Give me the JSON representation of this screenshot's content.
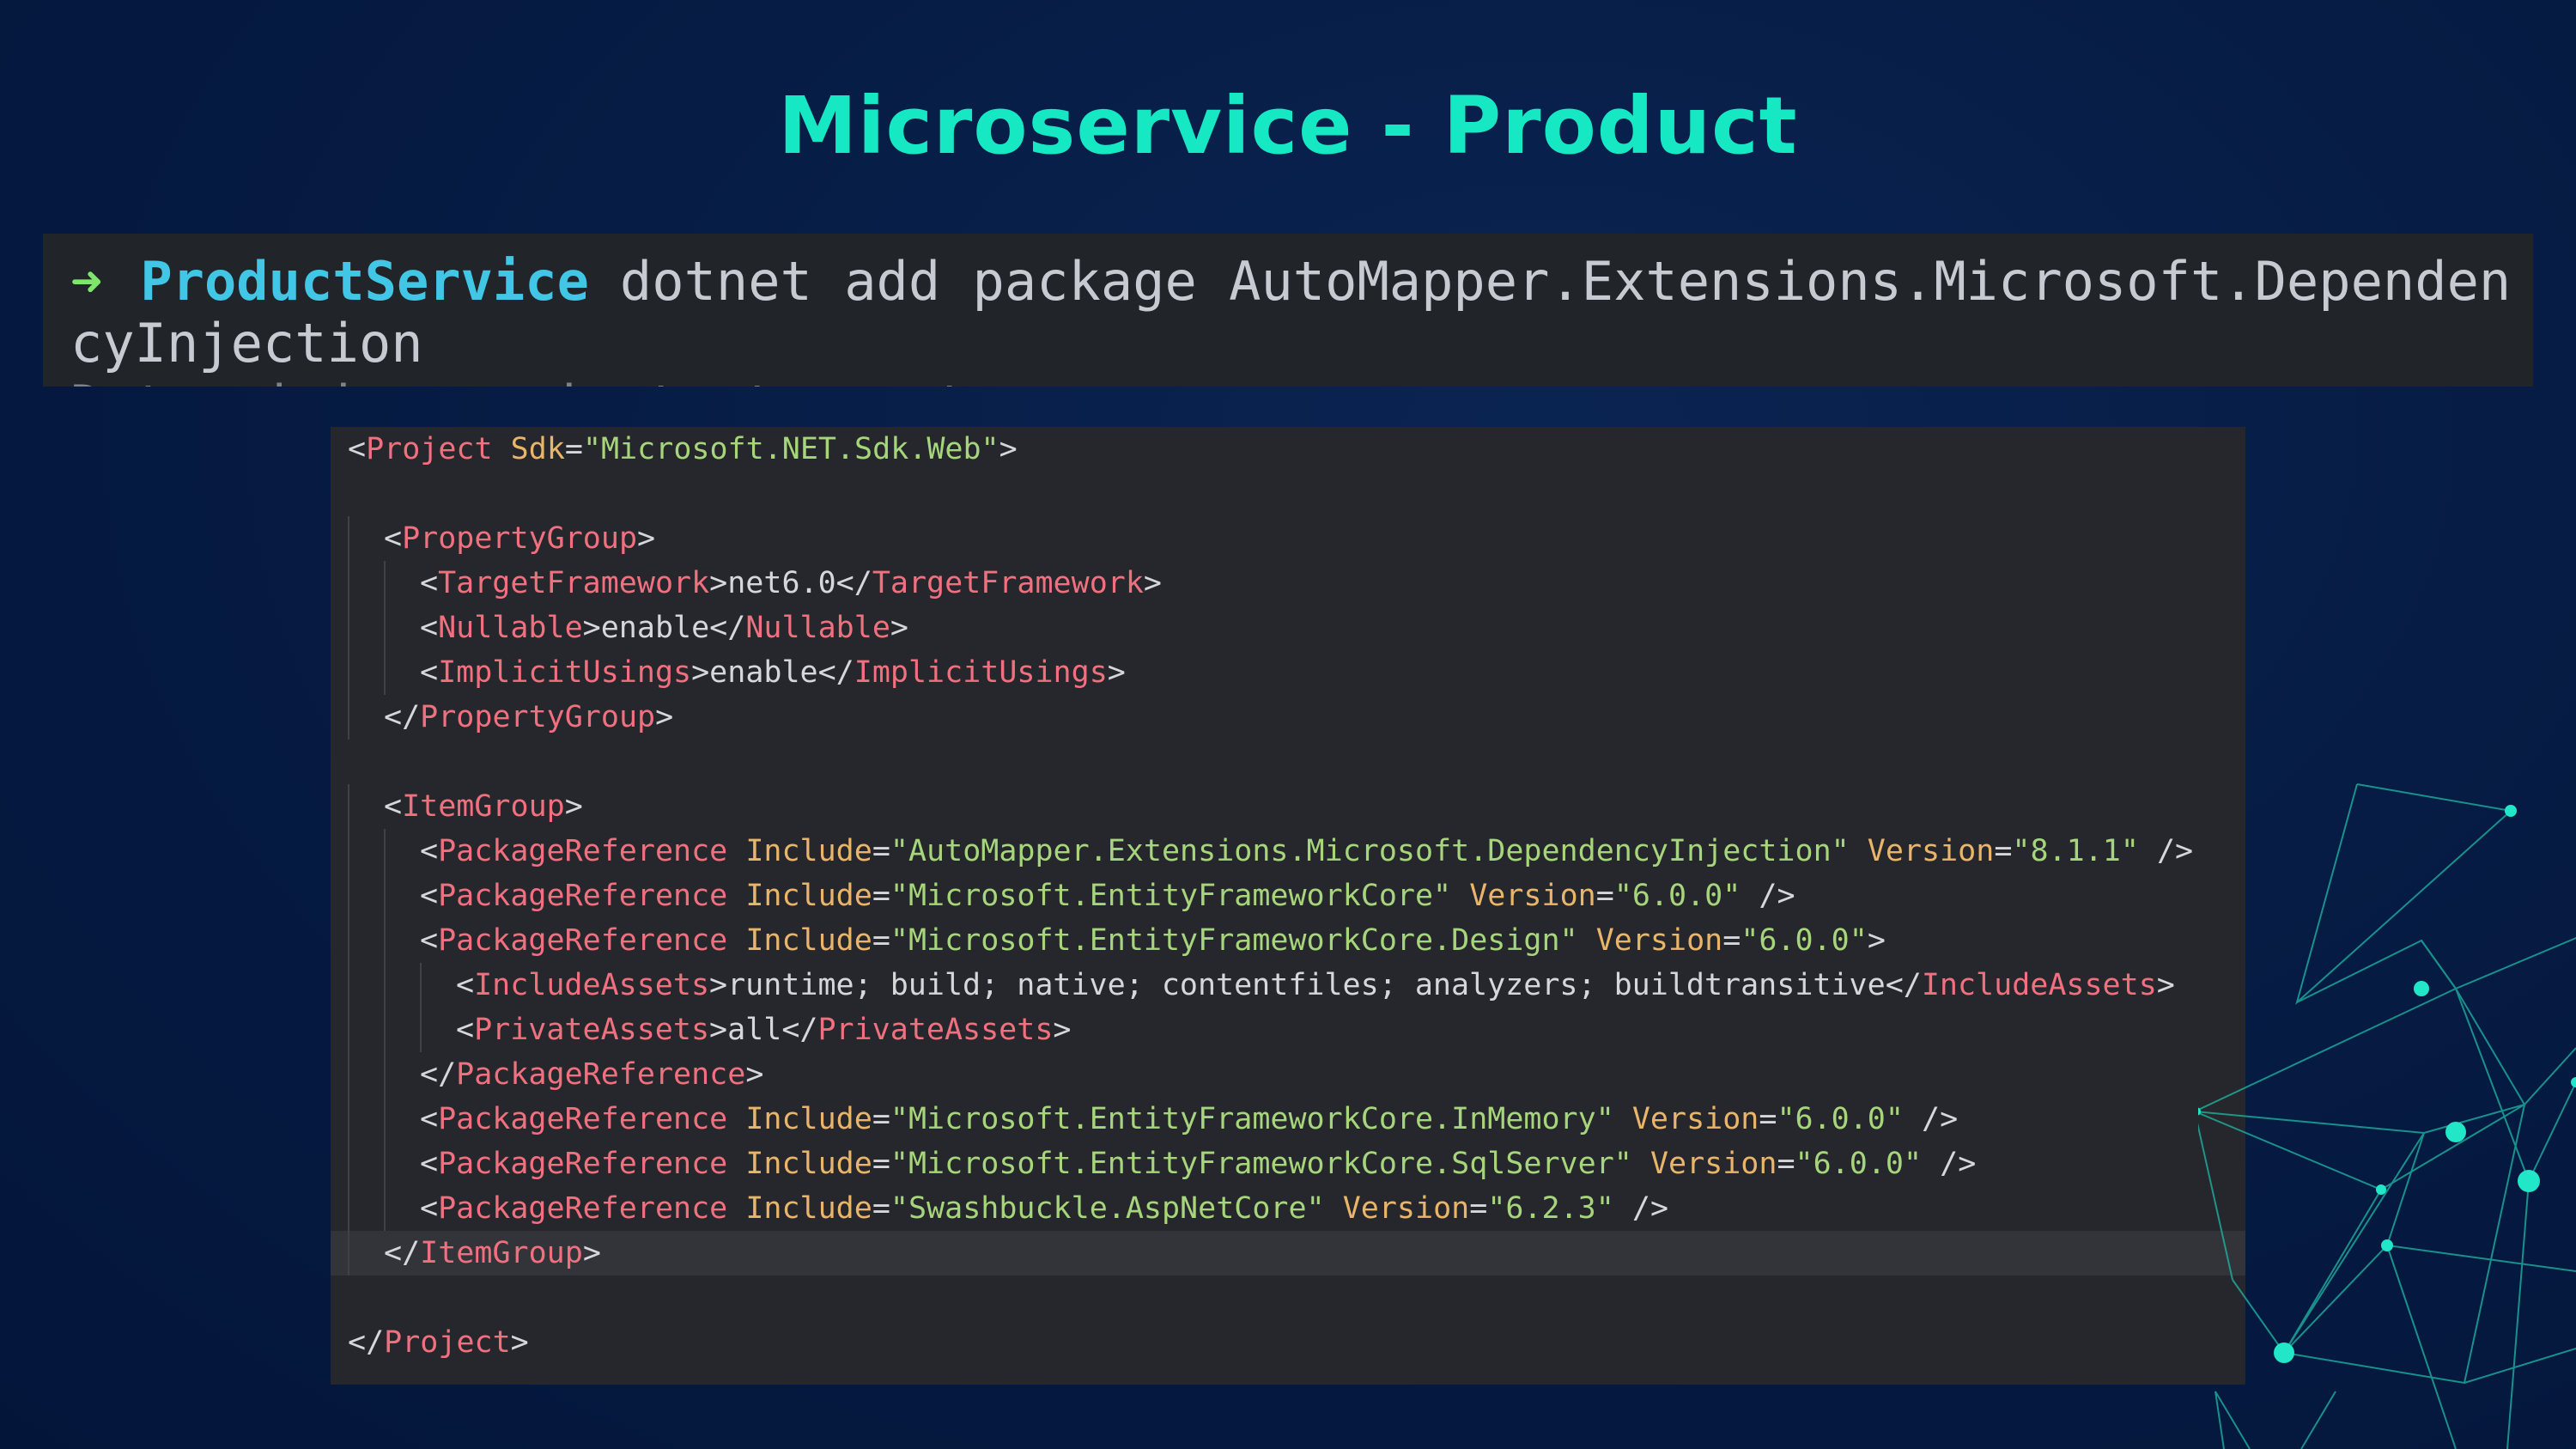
{
  "slide": {
    "title": "Microservice - Product",
    "title_color": "#17e8c4"
  },
  "terminal": {
    "prompt_symbol": "➜",
    "directory": "ProductService",
    "command_part1": "dotnet add package AutoMapper.Extensions.Microsoft.Dependen",
    "command_part2": "cyInjection",
    "partial_next_line": "  Determining projects to restore..."
  },
  "code": {
    "language": "xml",
    "lines": [
      {
        "indent": 0,
        "tokens": [
          [
            "punc",
            "<"
          ],
          [
            "tag",
            "Project"
          ],
          [
            "punc",
            " "
          ],
          [
            "attr",
            "Sdk"
          ],
          [
            "punc",
            "="
          ],
          [
            "str",
            "\"Microsoft.NET.Sdk.Web\""
          ],
          [
            "punc",
            ">"
          ]
        ]
      },
      {
        "indent": 0,
        "tokens": []
      },
      {
        "indent": 1,
        "tokens": [
          [
            "punc",
            "<"
          ],
          [
            "tag",
            "PropertyGroup"
          ],
          [
            "punc",
            ">"
          ]
        ]
      },
      {
        "indent": 2,
        "tokens": [
          [
            "punc",
            "<"
          ],
          [
            "tag",
            "TargetFramework"
          ],
          [
            "punc",
            ">"
          ],
          [
            "txt",
            "net6.0"
          ],
          [
            "punc",
            "</"
          ],
          [
            "tag",
            "TargetFramework"
          ],
          [
            "punc",
            ">"
          ]
        ]
      },
      {
        "indent": 2,
        "tokens": [
          [
            "punc",
            "<"
          ],
          [
            "tag",
            "Nullable"
          ],
          [
            "punc",
            ">"
          ],
          [
            "txt",
            "enable"
          ],
          [
            "punc",
            "</"
          ],
          [
            "tag",
            "Nullable"
          ],
          [
            "punc",
            ">"
          ]
        ]
      },
      {
        "indent": 2,
        "tokens": [
          [
            "punc",
            "<"
          ],
          [
            "tag",
            "ImplicitUsings"
          ],
          [
            "punc",
            ">"
          ],
          [
            "txt",
            "enable"
          ],
          [
            "punc",
            "</"
          ],
          [
            "tag",
            "ImplicitUsings"
          ],
          [
            "punc",
            ">"
          ]
        ]
      },
      {
        "indent": 1,
        "tokens": [
          [
            "punc",
            "</"
          ],
          [
            "tag",
            "PropertyGroup"
          ],
          [
            "punc",
            ">"
          ]
        ]
      },
      {
        "indent": 0,
        "tokens": []
      },
      {
        "indent": 1,
        "tokens": [
          [
            "punc",
            "<"
          ],
          [
            "tag",
            "ItemGroup"
          ],
          [
            "punc",
            ">"
          ]
        ]
      },
      {
        "indent": 2,
        "tokens": [
          [
            "punc",
            "<"
          ],
          [
            "tag",
            "PackageReference"
          ],
          [
            "punc",
            " "
          ],
          [
            "attr",
            "Include"
          ],
          [
            "punc",
            "="
          ],
          [
            "str",
            "\"AutoMapper.Extensions.Microsoft.DependencyInjection\""
          ],
          [
            "punc",
            " "
          ],
          [
            "attr",
            "Version"
          ],
          [
            "punc",
            "="
          ],
          [
            "str",
            "\"8.1.1\""
          ],
          [
            "punc",
            " />"
          ]
        ]
      },
      {
        "indent": 2,
        "tokens": [
          [
            "punc",
            "<"
          ],
          [
            "tag",
            "PackageReference"
          ],
          [
            "punc",
            " "
          ],
          [
            "attr",
            "Include"
          ],
          [
            "punc",
            "="
          ],
          [
            "str",
            "\"Microsoft.EntityFrameworkCore\""
          ],
          [
            "punc",
            " "
          ],
          [
            "attr",
            "Version"
          ],
          [
            "punc",
            "="
          ],
          [
            "str",
            "\"6.0.0\""
          ],
          [
            "punc",
            " />"
          ]
        ]
      },
      {
        "indent": 2,
        "tokens": [
          [
            "punc",
            "<"
          ],
          [
            "tag",
            "PackageReference"
          ],
          [
            "punc",
            " "
          ],
          [
            "attr",
            "Include"
          ],
          [
            "punc",
            "="
          ],
          [
            "str",
            "\"Microsoft.EntityFrameworkCore.Design\""
          ],
          [
            "punc",
            " "
          ],
          [
            "attr",
            "Version"
          ],
          [
            "punc",
            "="
          ],
          [
            "str",
            "\"6.0.0\""
          ],
          [
            "punc",
            ">"
          ]
        ]
      },
      {
        "indent": 3,
        "tokens": [
          [
            "punc",
            "<"
          ],
          [
            "tag",
            "IncludeAssets"
          ],
          [
            "punc",
            ">"
          ],
          [
            "txt",
            "runtime; build; native; contentfiles; analyzers; buildtransitive"
          ],
          [
            "punc",
            "</"
          ],
          [
            "tag",
            "IncludeAssets"
          ],
          [
            "punc",
            ">"
          ]
        ]
      },
      {
        "indent": 3,
        "tokens": [
          [
            "punc",
            "<"
          ],
          [
            "tag",
            "PrivateAssets"
          ],
          [
            "punc",
            ">"
          ],
          [
            "txt",
            "all"
          ],
          [
            "punc",
            "</"
          ],
          [
            "tag",
            "PrivateAssets"
          ],
          [
            "punc",
            ">"
          ]
        ]
      },
      {
        "indent": 2,
        "tokens": [
          [
            "punc",
            "</"
          ],
          [
            "tag",
            "PackageReference"
          ],
          [
            "punc",
            ">"
          ]
        ]
      },
      {
        "indent": 2,
        "tokens": [
          [
            "punc",
            "<"
          ],
          [
            "tag",
            "PackageReference"
          ],
          [
            "punc",
            " "
          ],
          [
            "attr",
            "Include"
          ],
          [
            "punc",
            "="
          ],
          [
            "str",
            "\"Microsoft.EntityFrameworkCore.InMemory\""
          ],
          [
            "punc",
            " "
          ],
          [
            "attr",
            "Version"
          ],
          [
            "punc",
            "="
          ],
          [
            "str",
            "\"6.0.0\""
          ],
          [
            "punc",
            " />"
          ]
        ]
      },
      {
        "indent": 2,
        "tokens": [
          [
            "punc",
            "<"
          ],
          [
            "tag",
            "PackageReference"
          ],
          [
            "punc",
            " "
          ],
          [
            "attr",
            "Include"
          ],
          [
            "punc",
            "="
          ],
          [
            "str",
            "\"Microsoft.EntityFrameworkCore.SqlServer\""
          ],
          [
            "punc",
            " "
          ],
          [
            "attr",
            "Version"
          ],
          [
            "punc",
            "="
          ],
          [
            "str",
            "\"6.0.0\""
          ],
          [
            "punc",
            " />"
          ]
        ]
      },
      {
        "indent": 2,
        "tokens": [
          [
            "punc",
            "<"
          ],
          [
            "tag",
            "PackageReference"
          ],
          [
            "punc",
            " "
          ],
          [
            "attr",
            "Include"
          ],
          [
            "punc",
            "="
          ],
          [
            "str",
            "\"Swashbuckle.AspNetCore\""
          ],
          [
            "punc",
            " "
          ],
          [
            "attr",
            "Version"
          ],
          [
            "punc",
            "="
          ],
          [
            "str",
            "\"6.2.3\""
          ],
          [
            "punc",
            " />"
          ]
        ]
      },
      {
        "indent": 1,
        "highlight": true,
        "tokens": [
          [
            "punc",
            "</"
          ],
          [
            "tag",
            "ItemGroup"
          ],
          [
            "punc",
            ">"
          ]
        ]
      },
      {
        "indent": 0,
        "tokens": []
      },
      {
        "indent": 0,
        "tokens": [
          [
            "punc",
            "</"
          ],
          [
            "tag",
            "Project"
          ],
          [
            "punc",
            ">"
          ]
        ]
      }
    ]
  },
  "colors": {
    "background": "#061c44",
    "accent": "#17e8c4",
    "tag": "#f0707f",
    "attribute": "#e9b56a",
    "string": "#a6d57b"
  }
}
